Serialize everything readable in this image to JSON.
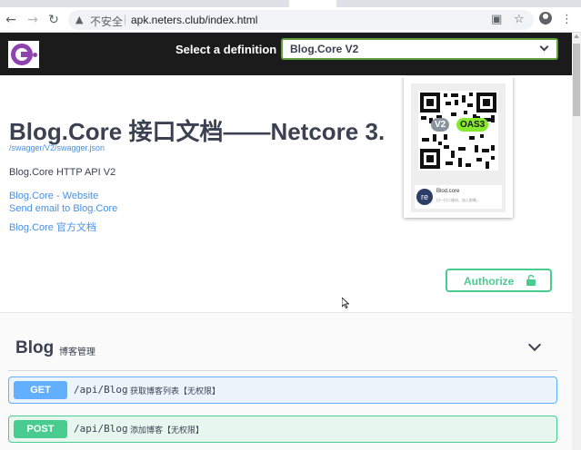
{
  "browser": {
    "back_icon": "arrow-left-icon",
    "forward_icon": "arrow-right-icon",
    "reload_icon": "reload-icon",
    "security_label": "不安全",
    "separator": "|",
    "url": "apk.neters.club/index.html"
  },
  "topbar": {
    "definition_label": "Select a definition",
    "selected_definition": "Blog.Core V2"
  },
  "info": {
    "title": "Blog.Core 接口文档——Netcore 3.",
    "swagger_url": "/swagger/V2/swagger.json",
    "description": "Blog.Core HTTP API V2",
    "links": [
      "Blog.Core - Website",
      "Send email to Blog.Core",
      "Blog.Core 官方文档"
    ]
  },
  "qr": {
    "badge_version": "V2",
    "badge_spec": "OAS3",
    "avatar_text": "re",
    "name": "Blod.core",
    "hint": "扫一扫二维码，加入群聊。"
  },
  "authorize": {
    "label": "Authorize"
  },
  "tag": {
    "name": "Blog",
    "description": "博客管理"
  },
  "operations": [
    {
      "method": "GET",
      "path": "/api/Blog",
      "summary": "获取博客列表【无权限】"
    },
    {
      "method": "POST",
      "path": "/api/Blog",
      "summary": "添加博客【无权限】"
    }
  ],
  "colors": {
    "get": "#61affe",
    "post": "#49cc90",
    "link": "#4990e2",
    "topbar": "#1b1b1b",
    "select_border": "#62a03f"
  }
}
